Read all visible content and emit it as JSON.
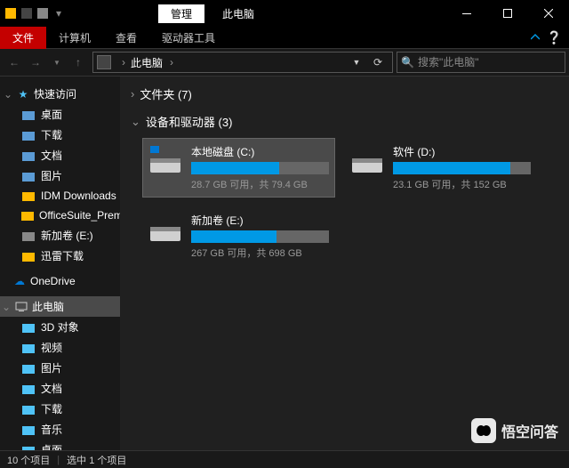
{
  "titlebar": {
    "manage_tab": "管理",
    "window_title": "此电脑"
  },
  "ribbon": {
    "file": "文件",
    "computer": "计算机",
    "view": "查看",
    "drive_tools": "驱动器工具"
  },
  "nav": {
    "address": "此电脑",
    "search_placeholder": "搜索\"此电脑\""
  },
  "sidebar": {
    "quick_access": {
      "label": "快速访问"
    },
    "quick_items": [
      {
        "label": "桌面"
      },
      {
        "label": "下载"
      },
      {
        "label": "文档"
      },
      {
        "label": "图片"
      },
      {
        "label": "IDM Downloads"
      },
      {
        "label": "OfficeSuite_Premium"
      },
      {
        "label": "新加卷 (E:)"
      },
      {
        "label": "迅雷下载"
      }
    ],
    "onedrive": "OneDrive",
    "this_pc": "此电脑",
    "pc_items": [
      {
        "label": "3D 对象"
      },
      {
        "label": "视频"
      },
      {
        "label": "图片"
      },
      {
        "label": "文档"
      },
      {
        "label": "下载"
      },
      {
        "label": "音乐"
      },
      {
        "label": "桌面"
      }
    ]
  },
  "main": {
    "folders_section": "文件夹 (7)",
    "drives_section": "设备和驱动器 (3)",
    "drives": [
      {
        "name": "本地磁盘 (C:)",
        "fill_pct": 64,
        "text": "28.7 GB 可用，共 79.4 GB",
        "selected": true,
        "system": true
      },
      {
        "name": "软件 (D:)",
        "fill_pct": 85,
        "text": "23.1 GB 可用，共 152 GB",
        "selected": false,
        "system": false
      },
      {
        "name": "新加卷 (E:)",
        "fill_pct": 62,
        "text": "267 GB 可用，共 698 GB",
        "selected": false,
        "system": false
      }
    ]
  },
  "statusbar": {
    "items": "10 个项目",
    "selected": "选中 1 个项目"
  },
  "watermark": "悟空问答"
}
